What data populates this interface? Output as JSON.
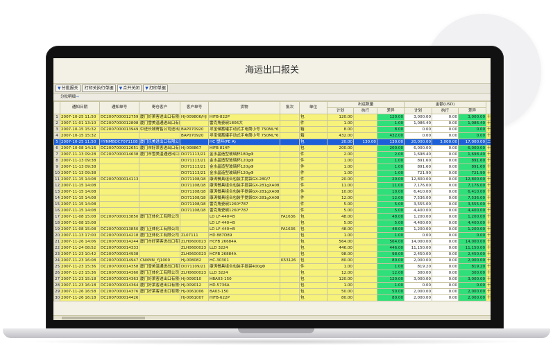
{
  "app": {
    "title": "海运出口报关"
  },
  "toolbar": [
    {
      "label": "分批报关",
      "tri": "▼"
    },
    {
      "label": "打印关执行单据",
      "tri": ""
    },
    {
      "label": "合并关闭",
      "tri": "▼"
    },
    {
      "label": "打印单据",
      "tri": "▼"
    }
  ],
  "groupbar": {
    "label": "分批明细"
  },
  "table": {
    "group_headers": {
      "plan_qty": "出运数量",
      "amount": "金额(USD)"
    },
    "columns": [
      "",
      "通知日期",
      "通知单号",
      "寄仓客户",
      "客户单号",
      "货物",
      "批次",
      "单位",
      "计划",
      "执行",
      "差异",
      "计划",
      "执行",
      "差异",
      ""
    ],
    "rows": [
      [
        "1",
        "2007-10-25 11:50",
        "DC2007000012759",
        "厦门好莱客进出口有限公司",
        "HJ-009806/HJ",
        "HIFB-822P",
        "",
        "包",
        "120.00",
        "",
        "120.00",
        "3,000.00",
        "0.00",
        "3,000.00",
        "十"
      ],
      [
        "2",
        "2007-11-01 13:10",
        "DC2007000012808",
        "厦门雪美温通进出口有限公司",
        "",
        "雷克角瓷碗1806大",
        "",
        "件",
        "1.00",
        "",
        "1.00",
        "1,086.40",
        "0.00",
        "1,086.40",
        "十"
      ],
      [
        "3",
        "2007-10-15 15:32",
        "DC2007000013949",
        "中进长城寄售公司进出口公司",
        "BAP070920",
        "寻宝储蓄罐手动式手电筒小号 750ML*6",
        "",
        "箱",
        "8.00",
        "",
        "8.00",
        "0.00",
        "0.00",
        "0.00",
        "十"
      ],
      [
        "4",
        "2007-10-15 15:32",
        "",
        "",
        "BAP070920",
        "寻宝储蓄罐手动式手电筒小号 750ML*6",
        "",
        "箱",
        "432.00",
        "",
        "432.00",
        "0.00",
        "0.00",
        "0.00",
        "十"
      ],
      [
        "5",
        "2007-10-25 11:50",
        "HYNMBOC7071108",
        "厦门乐美进出口有限公司",
        "",
        "HC 塑料(PE A)",
        "",
        "包",
        "20.00",
        "130.00",
        "130.00",
        "20,000.00",
        "3,000.00",
        "17,000.00",
        "二"
      ],
      [
        "6",
        "2007-10-08 14:16",
        "DC2007000012651",
        "厦门市好莱客进出口有限公司",
        "HJ-008867",
        "HIFB 814P",
        "",
        "包",
        "200.00",
        "",
        "200.00",
        "6,000.00",
        "0.00",
        "6,000.00",
        "十"
      ],
      [
        "7",
        "2007-11-13 09:28",
        "DC2007000014638",
        "厦门市雪美温通进出口有限公司",
        "DO71113/21",
        "金水晶造型玻璃杯180gΦ",
        "",
        "件",
        "2.00",
        "",
        "2.00",
        "1,698.40",
        "0.00",
        "1,698.40",
        "十"
      ],
      [
        "8",
        "2007-11-13 09:38",
        "",
        "",
        "DO71113/21",
        "金水晶造型玻璃杯120gΦ",
        "",
        "件",
        "1.00",
        "",
        "1.00",
        "891.60",
        "0.00",
        "891.60",
        "十"
      ],
      [
        "9",
        "2007-11-13 09:38",
        "",
        "",
        "DO71113/21",
        "金水晶造型玻璃杯120gΦ",
        "",
        "件",
        "1.00",
        "",
        "1.00",
        "891.60",
        "0.00",
        "891.60",
        "十"
      ],
      [
        "10",
        "2007-11-13 09:38",
        "",
        "",
        "DO71113/21",
        "金水晶造型玻璃杯120gΦ",
        "",
        "件",
        "1.00",
        "",
        "1.00",
        "721.90",
        "0.00",
        "721.90",
        "十"
      ],
      [
        "11",
        "2007-11-15 14:08",
        "DC2007000014113",
        "",
        "DO71108/18",
        "康涛餐具组合包装手提袋GX-280/7",
        "",
        "件",
        "20.00",
        "",
        "20.00",
        "12,800.00",
        "0.00",
        "12,800.00",
        "十"
      ],
      [
        "12",
        "2007-11-15 14:08",
        "",
        "",
        "DO71108/18",
        "康涛餐具组合包装手提袋GX-281gXA08",
        "",
        "件",
        "11.00",
        "",
        "11.00",
        "7,176.00",
        "0.00",
        "7,176.00",
        "十"
      ],
      [
        "13",
        "2007-11-15 14:08",
        "",
        "",
        "DO71108/18",
        "康涛餐具组合包装手提袋GX-281gXA08",
        "",
        "件",
        "10.00",
        "",
        "10.00",
        "6,410.00",
        "0.00",
        "6,410.00",
        "十"
      ],
      [
        "14",
        "2007-11-15 14:08",
        "",
        "",
        "DO71108/18",
        "康涛餐具组合包装手提袋GX-281gXA08",
        "",
        "件",
        "12.00",
        "",
        "12.00",
        "7,536.00",
        "0.00",
        "7,536.00",
        "十"
      ],
      [
        "15",
        "2007-11-15 14:08",
        "",
        "",
        "DO71108/18",
        "雷克角瓷碗1260*787",
        "",
        "件",
        "5.00",
        "",
        "5.00",
        "3,555.00",
        "0.00",
        "3,555.00",
        "十"
      ],
      [
        "16",
        "2007-11-15 14:08",
        "",
        "",
        "DO71108/18",
        "雷克角瓷碗1260*787",
        "",
        "件",
        "5.00",
        "",
        "5.00",
        "4,400.00",
        "0.00",
        "4,400.00",
        "十"
      ],
      [
        "17",
        "2007-11-08 15:08",
        "DC2007000013850",
        "厦门正体化工有限公司",
        "",
        "LD LF-440=B",
        "FA1636",
        "包",
        "48.00",
        "",
        "48.00",
        "1,200.00",
        "0.00",
        "1,200.00",
        "十"
      ],
      [
        "18",
        "2007-11-08 15:08",
        "",
        "",
        "",
        "LD LF-440=B",
        "",
        "包",
        "5.00",
        "",
        "5.00",
        "4,400.00",
        "0.00",
        "4,400.00",
        "十"
      ],
      [
        "19",
        "2007-11-08 15:08",
        "DC2007000013850",
        "厦门正体化工有限公司",
        "",
        "LD LF-440=B",
        "FA1636",
        "包",
        "48.00",
        "",
        "48.00",
        "1,200.00",
        "0.00",
        "1,200.00",
        "十"
      ],
      [
        "20",
        "2007-11-13 17:00",
        "DC2007000014218",
        "厦门正体化工有限公司",
        "ZL07111",
        "HD 887D89",
        "",
        "包",
        "1.00",
        "",
        "1.00",
        "0.00",
        "0.00",
        "0.00",
        "十"
      ],
      [
        "21",
        "2007-11-26 14:06",
        "DC2007000014244",
        "厦门市好莱客进出口有限公司",
        "ZLH0600023",
        "HCFB 26684A",
        "",
        "包",
        "564.00",
        "",
        "564.00",
        "14,000.00",
        "0.00",
        "14,000.00",
        "十"
      ],
      [
        "22",
        "2007-11-24 08:52",
        "DC2007000014333",
        "",
        "ZLH0600023",
        "LLD 3224",
        "",
        "包",
        "446.00",
        "",
        "446.00",
        "11,150.00",
        "0.00",
        "11,150.00",
        "十"
      ],
      [
        "23",
        "2007-11-23 10:42",
        "DC2007000014938",
        "",
        "ZLH0600023",
        "HCFB 26884A",
        "",
        "包",
        "98.00",
        "",
        "98.00",
        "2,450.00",
        "0.00",
        "2,450.00",
        "十"
      ],
      [
        "24",
        "2007-11-23 16:08",
        "DC2007000014947",
        "CNXMN_YJ1000",
        "HJ-008082",
        "HC-30301",
        "K53126",
        "包",
        "80.00",
        "",
        "80.00",
        "2,000.00",
        "0.00",
        "2,000.00",
        "十"
      ],
      [
        "25",
        "2007-11-23 15:36",
        "DC2007000014358",
        "厦门雪美温通进出口有限公司",
        "DO71109/21",
        "康涛餐具组合包装手提袋400gΦ",
        "",
        "件",
        "1.00",
        "",
        "1.00",
        "819.20",
        "0.00",
        "819.20",
        "十"
      ],
      [
        "26",
        "2007-11-23 15:36",
        "DC2007000014360",
        "厦门正体化工有限公司",
        "ZLH0600023",
        "LLD 3224",
        "",
        "包",
        "12.00",
        "",
        "12.00",
        "300.00",
        "0.00",
        "300.00",
        "十"
      ],
      [
        "27",
        "2007-11-23 15:18",
        "DC2007000014363",
        "厦门好莱客进出口有限公司",
        "HJ-009010",
        "HBA03-150",
        "",
        "包",
        "120.00",
        "",
        "120.00",
        "3,000.00",
        "0.00",
        "3,000.00",
        "十"
      ],
      [
        "28",
        "2007-11-23 16:18",
        "DC2007000014364",
        "厦门好莱客进出口有限公司",
        "HJ-009012",
        "HD-5736A",
        "",
        "包",
        "1.00",
        "",
        "1.00",
        "0.00",
        "0.00",
        "0.00",
        "十"
      ],
      [
        "29",
        "2007-11-26 16:58",
        "DC2007000014376",
        "厦门好莱客进出口有限公司",
        "HJ-0061006",
        "BA03-150",
        "",
        "包",
        "50.00",
        "",
        "50.00",
        "2,000.00",
        "0.00",
        "2,000.00",
        "十"
      ],
      [
        "30",
        "2007-11-26 16:18",
        "DC2007000014426",
        "",
        "HJ-0061007",
        "HIFB-622P",
        "",
        "包",
        "80.00",
        "",
        "80.00",
        "2,000.00",
        "0.00",
        "2,000.00",
        "十"
      ]
    ],
    "selected_row": 4
  },
  "colors": {
    "row_yellow": "#f6f27a",
    "diff_green": "#2fe07a",
    "selection_blue": "#1d5fd8"
  }
}
